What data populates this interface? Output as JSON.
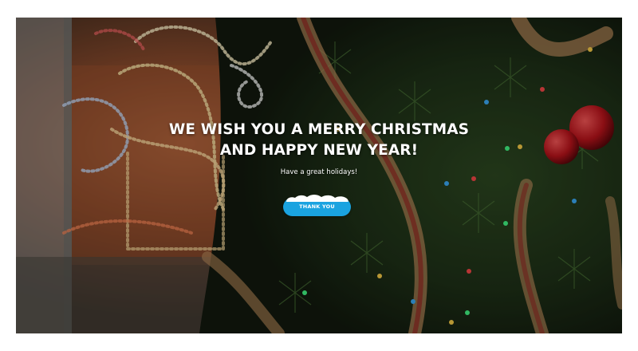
{
  "hero": {
    "headline_line1": "WE WISH YOU A MERRY CHRISTMAS",
    "headline_line2": "AND HAPPY NEW YEAR!",
    "subtitle": "Have a great holidays!",
    "button_label": "THANK YOU"
  },
  "colors": {
    "button": "#1aa3e0",
    "text": "#ffffff",
    "snow": "#ffffff"
  }
}
